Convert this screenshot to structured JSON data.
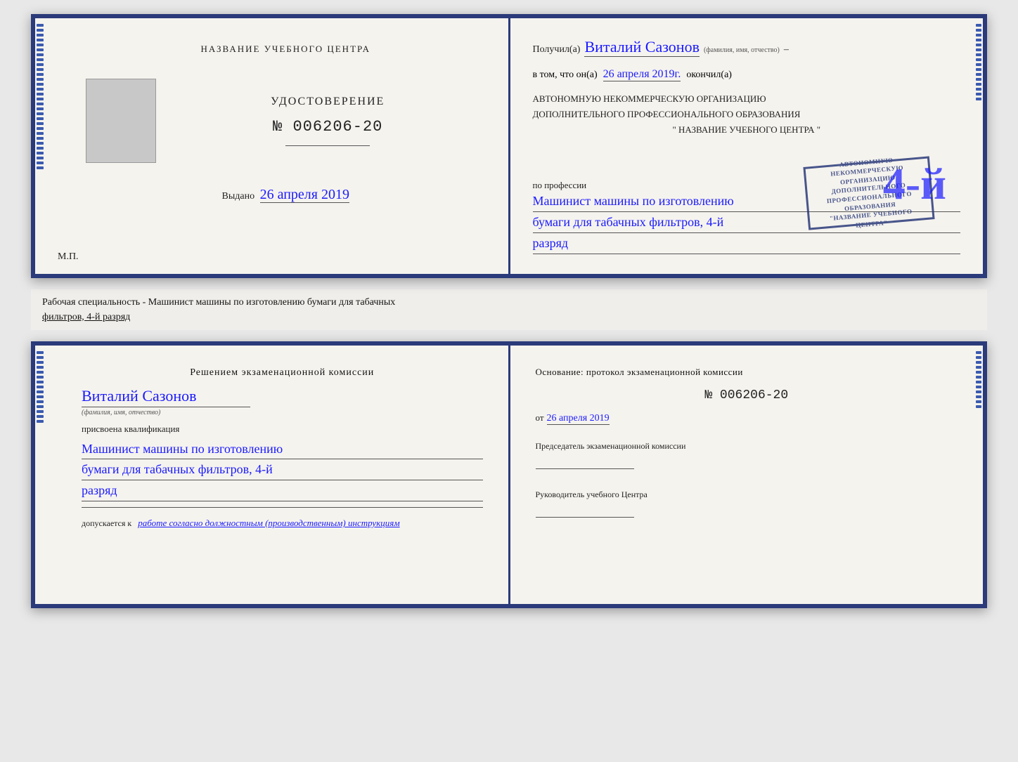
{
  "top_booklet": {
    "left": {
      "org_name_label": "НАЗВАНИЕ УЧЕБНОГО ЦЕНТРА",
      "cert_title": "УДОСТОВЕРЕНИЕ",
      "cert_number": "№ 006206-20",
      "issued_label": "Выдано",
      "issued_date": "26 апреля 2019",
      "mp_label": "М.П."
    },
    "right": {
      "received_prefix": "Получил(а)",
      "recipient_name": "Виталий Сазонов",
      "fio_label": "(фамилия, имя, отчество)",
      "in_that_prefix": "в том, что он(а)",
      "date_value": "26 апреля 2019г.",
      "finished_label": "окончил(а)",
      "org_line1": "АВТОНОМНУЮ НЕКОММЕРЧЕСКУЮ ОРГАНИЗАЦИЮ",
      "org_line2": "ДОПОЛНИТЕЛЬНОГО ПРОФЕССИОНАЛЬНОГО ОБРАЗОВАНИЯ",
      "org_name_quoted": "\" НАЗВАНИЕ УЧЕБНОГО ЦЕНТРА \"",
      "profession_prefix": "по профессии",
      "profession_line1": "Машинист машины по изготовлению",
      "profession_line2": "бумаги для табачных фильтров, 4-й",
      "profession_line3": "разряд",
      "stamp_line1": "4-й",
      "stamp_line2": "АВТОНОМНУЮ НЕКОММЕРЧЕСКУЮ ОРГАНИЗАЦИЮ",
      "stamp_line3": "ДОПОЛНИТЕЛЬНОГО ПРОФЕССИОНАЛЬНОГО",
      "stamp_line4": "ОБРАЗОВАНИЯ",
      "stamp_line5": "\" НАЗВАНИЕ УЧЕБНОГО ЦЕНТРА \""
    }
  },
  "description": {
    "text_prefix": "Рабочая специальность - Машинист машины по изготовлению бумаги для табачных",
    "text_underlined": "фильтров, 4-й разряд"
  },
  "bottom_booklet": {
    "left": {
      "commission_title": "Решением  экзаменационной  комиссии",
      "name_value": "Виталий Сазонов",
      "fio_label": "(фамилия, имя, отчество)",
      "assigned_label": "присвоена квалификация",
      "qualification_line1": "Машинист машины по изготовлению",
      "qualification_line2": "бумаги для табачных фильтров, 4-й",
      "qualification_line3": "разряд",
      "allowed_prefix": "допускается к",
      "allowed_value": "работе согласно должностным (производственным) инструкциям"
    },
    "right": {
      "basis_label": "Основание: протокол экзаменационной  комиссии",
      "number_value": "№  006206-20",
      "date_prefix": "от",
      "date_value": "26 апреля 2019",
      "chairman_label": "Председатель экзаменационной комиссии",
      "director_label": "Руководитель учебного Центра"
    }
  }
}
